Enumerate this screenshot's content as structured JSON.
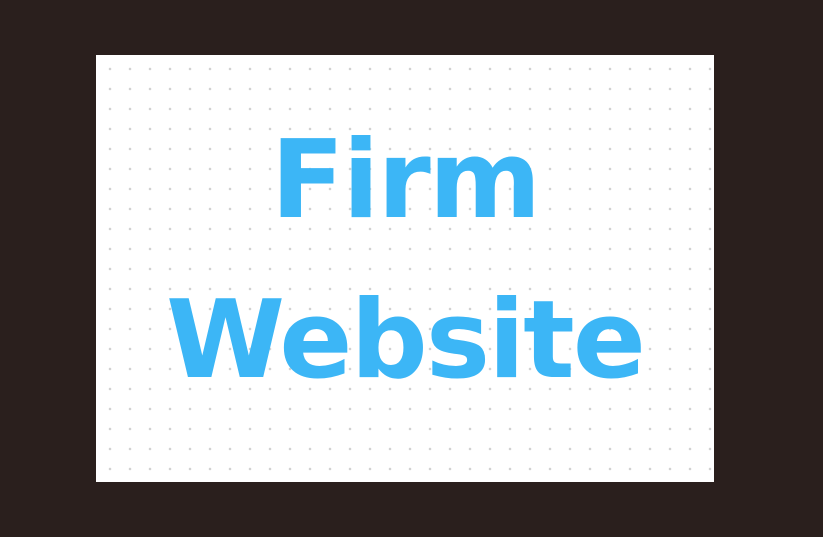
{
  "card": {
    "title_line_1": "Firm",
    "title_line_2": "Website"
  },
  "colors": {
    "background": "#2a1f1d",
    "card": "#ffffff",
    "title": "#3cb6f6",
    "dot": "#d2d2d2"
  }
}
